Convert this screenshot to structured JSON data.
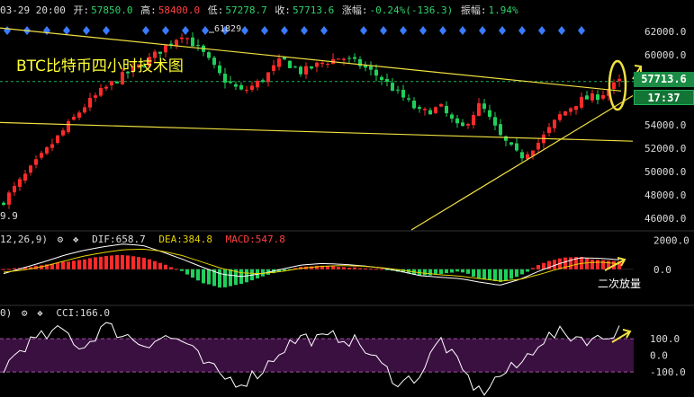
{
  "header": {
    "date": "03-29 20:00",
    "open_label": "开:",
    "open": "57850.0",
    "high_label": "高:",
    "high": "58400.0",
    "low_label": "低:",
    "low": "57278.7",
    "close_label": "收:",
    "close": "57713.6",
    "change_label": "涨幅:",
    "change": "-0.24%(-136.3)",
    "amp_label": "振幅:",
    "amp": "1.94%"
  },
  "chart_title": "BTC比特币四小时技术图",
  "annotations": {
    "high_marker": "61829",
    "left_low": "9.9",
    "macd_note": "二次放量"
  },
  "price_tags": {
    "price": "57713.6",
    "time": "17:37"
  },
  "macd_panel": {
    "params": "12,26,9)",
    "dif_label": "DIF:",
    "dif": "658.7",
    "dea_label": "DEA:",
    "dea": "384.8",
    "macd_label": "MACD:",
    "macd": "547.8"
  },
  "cci_panel": {
    "params": "0)",
    "cci_label": "CCI:",
    "cci": "166.0"
  },
  "colors": {
    "up": "#ff2a2a",
    "down": "#1fd05a",
    "trend": "#f0e040",
    "diamond": "#3a7bff",
    "cci_band": "#3a1040"
  },
  "icons": [
    "gear-icon",
    "settings-icon",
    "arrow-icon"
  ],
  "chart_data": [
    {
      "type": "candlestick",
      "ylim": [
        45000,
        63000
      ],
      "yticks": [
        "62000.0",
        "60000.0",
        "58000.0",
        "56000.0",
        "54000.0",
        "52000.0",
        "50000.0",
        "48000.0",
        "46000.0"
      ],
      "ytick_values": [
        62000,
        60000,
        58000,
        56000,
        54000,
        52000,
        50000,
        48000,
        46000
      ],
      "close_anchor": [
        47500,
        49500,
        51500,
        53500,
        55500,
        57000,
        58200,
        59200,
        60500,
        61829,
        60200,
        58000,
        56800,
        57800,
        59600,
        58500,
        59300,
        59800,
        59100,
        58000,
        56500,
        55000,
        55500,
        53500,
        55800,
        53000,
        51200,
        52600,
        54800,
        56100,
        56500,
        57713.6
      ]
    },
    {
      "type": "bar",
      "name": "MACD",
      "ylim": [
        -2500,
        2600
      ],
      "yticks": [
        "2000.0",
        "0.0"
      ],
      "ytick_values": [
        2000,
        0
      ],
      "hist_anchor": [
        0,
        120,
        280,
        500,
        700,
        880,
        1000,
        820,
        400,
        -150,
        -950,
        -1300,
        -1000,
        -500,
        -150,
        200,
        260,
        160,
        90,
        40,
        -200,
        -450,
        -350,
        -150,
        -650,
        -900,
        -450,
        350,
        780,
        860,
        620,
        547.8
      ],
      "dif_anchor": [
        -300,
        100,
        500,
        950,
        1300,
        1550,
        1750,
        1650,
        1200,
        700,
        150,
        -350,
        -500,
        -300,
        0,
        300,
        400,
        350,
        250,
        100,
        -150,
        -450,
        -550,
        -650,
        -900,
        -1100,
        -700,
        -100,
        400,
        800,
        760,
        658.7
      ],
      "dea_anchor": [
        -200,
        -50,
        200,
        550,
        900,
        1150,
        1350,
        1400,
        1250,
        950,
        500,
        50,
        -250,
        -300,
        -150,
        80,
        200,
        260,
        220,
        120,
        -50,
        -250,
        -380,
        -480,
        -650,
        -820,
        -700,
        -350,
        50,
        400,
        500,
        384.8
      ]
    },
    {
      "type": "line",
      "name": "CCI",
      "ylim": [
        -250,
        300
      ],
      "yticks": [
        "100.0",
        "0.0",
        "-100.0"
      ],
      "ytick_values": [
        100,
        0,
        -100
      ],
      "cci_anchor": [
        -80,
        60,
        110,
        150,
        40,
        180,
        130,
        70,
        110,
        90,
        -40,
        -130,
        -160,
        -90,
        40,
        110,
        90,
        120,
        60,
        -60,
        -170,
        -110,
        100,
        -80,
        -230,
        -120,
        -60,
        90,
        130,
        110,
        90,
        166.0
      ]
    }
  ]
}
